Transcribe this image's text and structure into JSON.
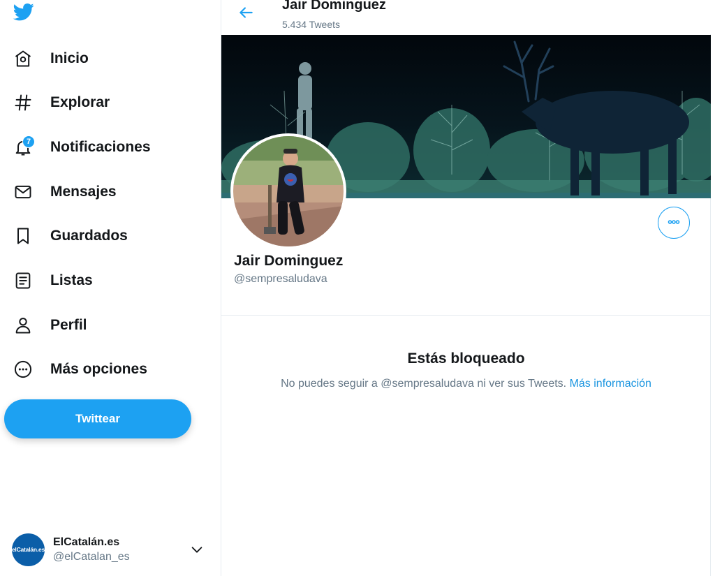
{
  "colors": {
    "accent": "#1da1f2",
    "text": "#14171a",
    "secondary": "#657786",
    "border": "#e6ecf0"
  },
  "sidebar": {
    "logo_icon": "twitter-bird-icon",
    "items": [
      {
        "label": "Inicio",
        "icon": "home-icon"
      },
      {
        "label": "Explorar",
        "icon": "hashtag-icon"
      },
      {
        "label": "Notificaciones",
        "icon": "bell-icon",
        "badge": "7"
      },
      {
        "label": "Mensajes",
        "icon": "envelope-icon"
      },
      {
        "label": "Guardados",
        "icon": "bookmark-icon"
      },
      {
        "label": "Listas",
        "icon": "list-icon"
      },
      {
        "label": "Perfil",
        "icon": "person-icon"
      },
      {
        "label": "Más opciones",
        "icon": "more-circle-icon"
      }
    ],
    "tweet_button": "Twittear",
    "account": {
      "avatar_text": "elCatalán.es",
      "name": "ElCatalán.es",
      "handle": "@elCatalan_es"
    }
  },
  "header": {
    "name": "Jair Dominguez",
    "tweet_count": "5.434 Tweets"
  },
  "profile": {
    "name": "Jair Dominguez",
    "handle": "@sempresaludava"
  },
  "blocked": {
    "title": "Estás bloqueado",
    "message": "No puedes seguir a @sempresaludava ni ver sus Tweets. ",
    "link": "Más información"
  }
}
